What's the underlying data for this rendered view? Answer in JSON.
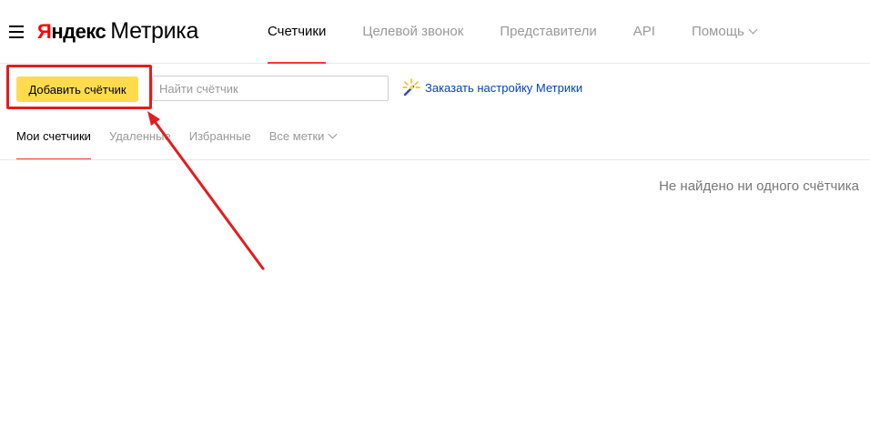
{
  "header": {
    "logo": {
      "brand_first_letter": "Я",
      "brand_rest": "ндекс",
      "product": "Метрика"
    },
    "nav": [
      {
        "label": "Счетчики",
        "active": true
      },
      {
        "label": "Целевой звонок",
        "active": false
      },
      {
        "label": "Представители",
        "active": false
      },
      {
        "label": "API",
        "active": false
      },
      {
        "label": "Помощь",
        "active": false,
        "has_dropdown": true
      }
    ]
  },
  "toolbar": {
    "add_button_label": "Добавить счётчик",
    "search_placeholder": "Найти счётчик",
    "search_value": "",
    "order_link_label": "Заказать настройку Метрики",
    "order_icon": "magic-wand-icon"
  },
  "subtabs": [
    {
      "label": "Мои счетчики",
      "active": true
    },
    {
      "label": "Удаленные",
      "active": false
    },
    {
      "label": "Избранные",
      "active": false
    },
    {
      "label": "Все метки",
      "active": false,
      "has_dropdown": true
    }
  ],
  "main": {
    "empty_message": "Не найдено ни одного счётчика"
  },
  "colors": {
    "accent_red": "#ff3333",
    "button_yellow": "#ffdb4d",
    "link_blue": "#0044bb",
    "annotation_red": "#e21e1e"
  }
}
